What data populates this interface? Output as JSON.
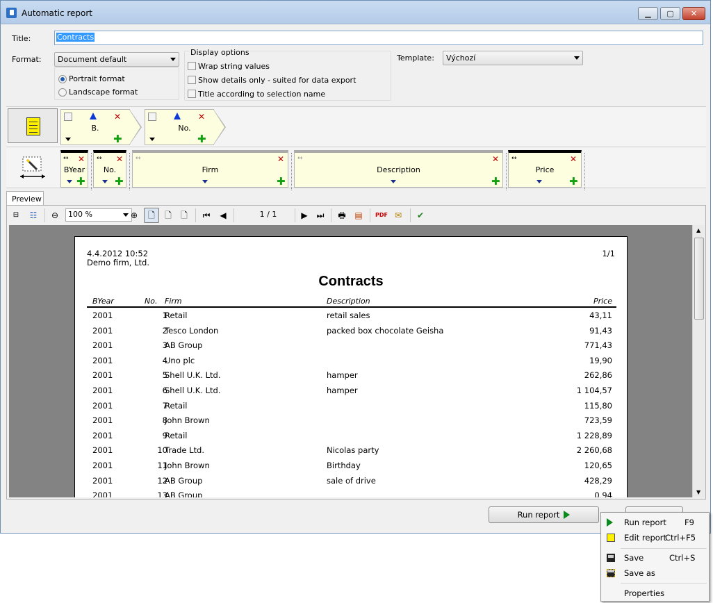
{
  "window": {
    "title": "Automatic report",
    "app_icon": "report-app-icon"
  },
  "form": {
    "title_label": "Title:",
    "title_value": "Contracts",
    "format_label": "Format:",
    "format_value": "Document default",
    "portrait_label": "Portrait format",
    "landscape_label": "Landscape format",
    "orientation_selected": "portrait",
    "display_options_label": "Display options",
    "wrap_label": "Wrap string values",
    "details_label": "Show details only - suited for data export",
    "title_sel_label": "Title according to selection name",
    "template_label": "Template:",
    "template_value": "Výchozí"
  },
  "sort_fields": [
    {
      "label": "B."
    },
    {
      "label": "No."
    }
  ],
  "columns": [
    {
      "label": "BYear"
    },
    {
      "label": "No."
    },
    {
      "label": "Firm"
    },
    {
      "label": "Description"
    },
    {
      "label": "Price"
    }
  ],
  "preview": {
    "tab_label": "Preview",
    "zoom": "100 %",
    "page": "1 / 1"
  },
  "report": {
    "datetime": "4.4.2012 10:52",
    "company": "Demo firm, Ltd.",
    "page_no": "1/1",
    "title": "Contracts",
    "headers": {
      "byear": "BYear",
      "no": "No.",
      "firm": "Firm",
      "description": "Description",
      "price": "Price"
    },
    "rows": [
      {
        "byear": "2001",
        "no": "1",
        "firm": "Retail",
        "description": "retail sales",
        "price": "43,11"
      },
      {
        "byear": "2001",
        "no": "2",
        "firm": "Tesco London",
        "description": "packed box chocolate Geisha",
        "price": "91,43"
      },
      {
        "byear": "2001",
        "no": "3",
        "firm": "AB Group",
        "description": "",
        "price": "771,43"
      },
      {
        "byear": "2001",
        "no": "4",
        "firm": "Uno plc",
        "description": "",
        "price": "19,90"
      },
      {
        "byear": "2001",
        "no": "5",
        "firm": "Shell U.K. Ltd.",
        "description": "hamper",
        "price": "262,86"
      },
      {
        "byear": "2001",
        "no": "6",
        "firm": "Shell U.K. Ltd.",
        "description": "hamper",
        "price": "1 104,57"
      },
      {
        "byear": "2001",
        "no": "7",
        "firm": "Retail",
        "description": "",
        "price": "115,80"
      },
      {
        "byear": "2001",
        "no": "8",
        "firm": "John Brown",
        "description": "",
        "price": "723,59"
      },
      {
        "byear": "2001",
        "no": "9",
        "firm": "Retail",
        "description": "",
        "price": "1 228,89"
      },
      {
        "byear": "2001",
        "no": "10",
        "firm": "Trade Ltd.",
        "description": "Nicolas party",
        "price": "2 260,68"
      },
      {
        "byear": "2001",
        "no": "11",
        "firm": "John Brown",
        "description": "Birthday",
        "price": "120,65"
      },
      {
        "byear": "2001",
        "no": "12",
        "firm": "AB Group",
        "description": "sale of drive",
        "price": "428,29"
      },
      {
        "byear": "2001",
        "no": "13",
        "firm": "AB Group",
        "description": "",
        "price": "0,94"
      }
    ]
  },
  "buttons": {
    "run_report": "Run report"
  },
  "context_menu": [
    {
      "label": "Run report",
      "shortcut": "F9",
      "icon": "run-icon"
    },
    {
      "label": "Edit report",
      "shortcut": "Ctrl+F5",
      "icon": "edit-icon"
    },
    {
      "label": "Save",
      "shortcut": "Ctrl+S",
      "icon": "save-icon"
    },
    {
      "label": "Save as",
      "shortcut": "",
      "icon": "save-as-icon"
    },
    {
      "label": "Properties",
      "shortcut": "",
      "icon": ""
    }
  ],
  "colors": {
    "accent": "#3399ff",
    "chip_bg": "#fdfde0",
    "remove_red": "#c00000",
    "add_green": "#10a010"
  }
}
